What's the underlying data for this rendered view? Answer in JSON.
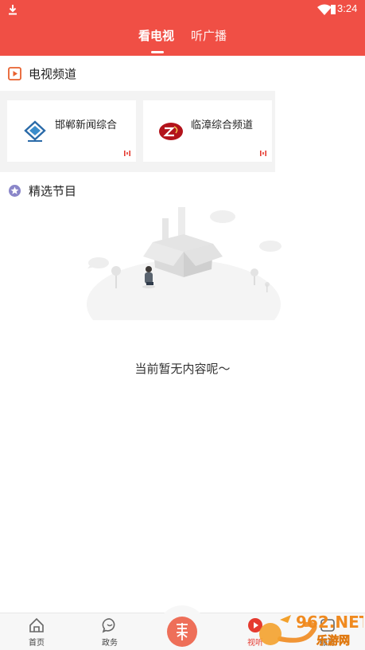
{
  "status_bar": {
    "time": "3:24",
    "icons": [
      "download-icon",
      "wifi-icon",
      "battery-icon"
    ]
  },
  "header": {
    "tabs": [
      {
        "label": "看电视",
        "active": true
      },
      {
        "label": "听广播",
        "active": false
      }
    ],
    "background_color": "#f04f45"
  },
  "tv_section": {
    "title": "电视频道",
    "icon": "tv-play-icon",
    "channels": [
      {
        "name": "邯郸新闻综合",
        "logo": "handan-news-logo"
      },
      {
        "name": "临漳综合频道",
        "logo": "linzhang-logo"
      }
    ]
  },
  "featured_section": {
    "title": "精选节目",
    "icon": "star-badge-icon"
  },
  "empty_state": {
    "message": "当前暂无内容呢～"
  },
  "bottom_nav": {
    "items": [
      {
        "label": "首页",
        "icon": "home-icon"
      },
      {
        "label": "政务",
        "icon": "chat-icon"
      },
      {
        "label": "视听",
        "icon": "play-icon",
        "active": true
      },
      {
        "label": "服务",
        "icon": "service-icon"
      }
    ],
    "center_icon": "brand-seal-icon"
  },
  "watermark": {
    "brand": "962.NET",
    "site": "乐游网"
  },
  "accent_color": "#e53a2f"
}
